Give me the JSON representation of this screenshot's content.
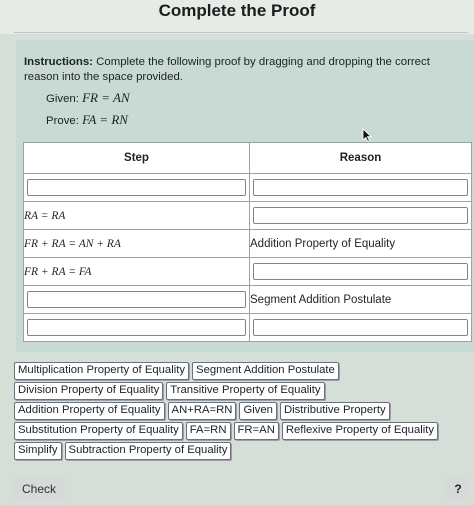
{
  "header": {
    "title": "Complete the Proof"
  },
  "instructions": {
    "label": "Instructions:",
    "text": "Complete the following proof by dragging and dropping the correct reason into the space provided."
  },
  "given": {
    "label": "Given:",
    "expr": "FR = AN"
  },
  "prove": {
    "label": "Prove:",
    "expr": "FA = RN"
  },
  "proof_table": {
    "headers": {
      "step": "Step",
      "reason": "Reason"
    },
    "rows": [
      {
        "step": "",
        "reason": ""
      },
      {
        "step": "RA = RA",
        "reason": ""
      },
      {
        "step": "FR + RA = AN + RA",
        "reason": "Addition Property of Equality"
      },
      {
        "step": "FR + RA = FA",
        "reason": ""
      },
      {
        "step": "",
        "reason": "Segment Addition Postulate"
      },
      {
        "step": "",
        "reason": ""
      }
    ]
  },
  "answer_bank": {
    "rows": [
      [
        "Multiplication Property of Equality",
        "Segment Addition Postulate"
      ],
      [
        "Division Property of Equality",
        "Transitive Property of Equality"
      ],
      [
        "Addition Property of Equality",
        "AN+RA=RN",
        "Given",
        "Distributive Property"
      ],
      [
        "Substitution Property of Equality",
        "FA=RN",
        "FR=AN",
        "Reflexive Property of Equality"
      ],
      [
        "Simplify",
        "Subtraction Property of Equality"
      ]
    ]
  },
  "footer": {
    "check_label": "Check",
    "help_label": "?"
  },
  "colors": {
    "background": "#d5dfd8",
    "card": "#c9d9d4",
    "chip_border": "#6a7178"
  }
}
